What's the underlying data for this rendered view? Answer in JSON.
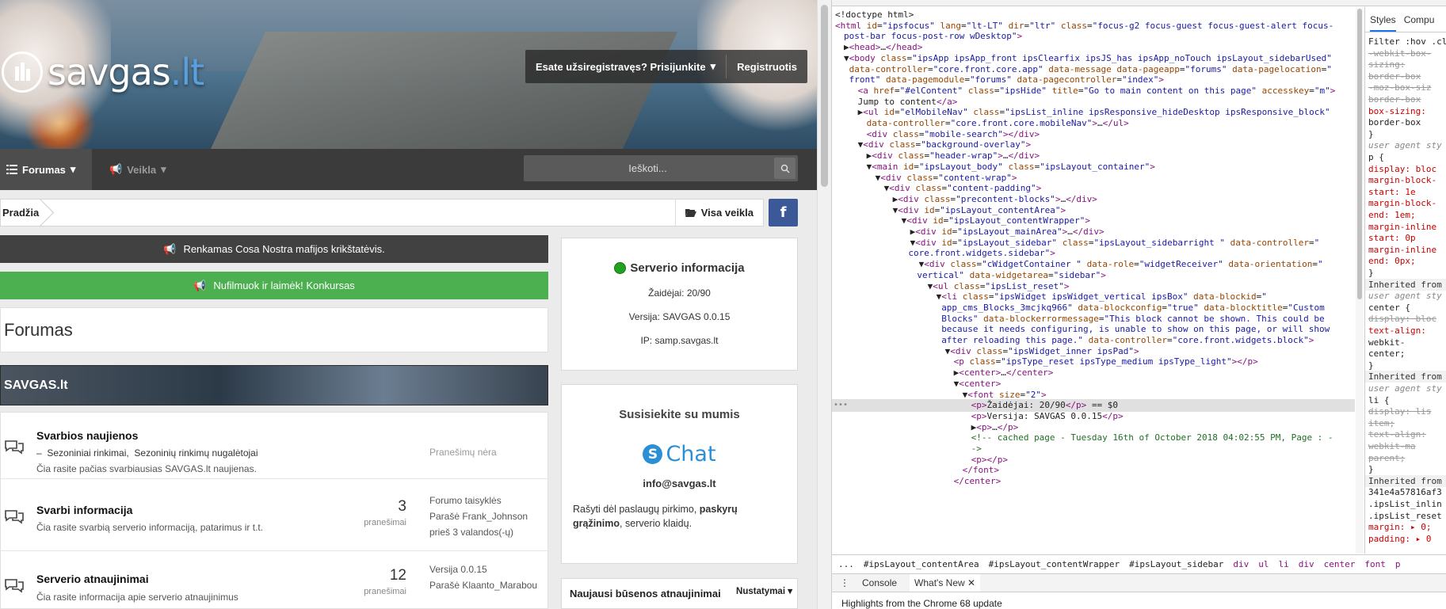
{
  "site": {
    "logo": {
      "name": "savgas",
      "tld": ".lt"
    },
    "userbar": {
      "login": "Esate užsiregistravęs? Prisijunkite",
      "register": "Registruotis"
    },
    "nav": {
      "forums": "Forumas",
      "activity": "Veikla"
    },
    "search": {
      "placeholder": "Ieškoti..."
    },
    "breadcrumb": {
      "home": "Pradžia",
      "all_activity": "Visa veikla"
    },
    "facebook": "f",
    "announcements": [
      "Renkamas Cosa Nostra mafijos krikštatėvis.",
      "Nufilmuok ir laimėk! Konkursas"
    ],
    "page_title": "Forumas",
    "category": "SAVGAS.lt",
    "forums": [
      {
        "title": "Svarbios naujienos",
        "subforums": [
          "Sezoniniai rinkimai,",
          "Sezoninių rinkimų nugalėtojai"
        ],
        "desc": "Čia rasite pačias svarbiausias SAVGAS.lt naujienas.",
        "empty": "Pranešimų nėra"
      },
      {
        "title": "Svarbi informacija",
        "desc": "Čia rasite svarbią serverio informaciją, patarimus ir t.t.",
        "count": "3",
        "count_label": "pranešimai",
        "last_title": "Forumo taisyklės",
        "last_by": "Parašė Frank_Johnson",
        "last_time": "prieš 3 valandos(-ų)"
      },
      {
        "title": "Serverio atnaujinimai",
        "desc": "Čia rasite informacija apie serverio atnaujinimus",
        "count": "12",
        "count_label": "pranešimai",
        "last_title": "Versija 0.0.15",
        "last_by": "Parašė Klaanto_Marabou"
      }
    ],
    "server_widget": {
      "title": "Serverio informacija",
      "players": "Žaidėjai: 20/90",
      "version": "Versija: SAVGAS 0.0.15",
      "ip_label": "IP: ",
      "ip": "samp.savgas.lt",
      "status_color": "#22a022"
    },
    "contact_widget": {
      "title": "Susisiekite su mumis",
      "chat": "Chat",
      "email": "info@savgas.lt",
      "text_pre": "Rašyti dėl paslaugų pirkimo, ",
      "text_bold": "paskyrų grąžinimo",
      "text_post": ", serverio klaidų."
    },
    "status_widget": {
      "title": "Naujausi būsenos atnaujinimai",
      "settings": "Nustatymai"
    }
  },
  "devtools": {
    "styles_tabs": [
      "Styles",
      "Compu"
    ],
    "styles_lines": [
      {
        "t": "Filter :hov .cl",
        "c": ""
      },
      {
        "t": "-webkit-box-",
        "c": "s"
      },
      {
        "t": "  sizing:",
        "c": "s"
      },
      {
        "t": "  border-box",
        "c": "s"
      },
      {
        "t": "-moz-box-siz",
        "c": "s"
      },
      {
        "t": "  border-box",
        "c": "s"
      },
      {
        "t": "box-sizing:",
        "c": "k"
      },
      {
        "t": "  border-box",
        "c": ""
      },
      {
        "t": "}",
        "c": ""
      },
      {
        "t": "user agent sty",
        "c": "g"
      },
      {
        "t": "p {",
        "c": ""
      },
      {
        "t": "  display: bloc",
        "c": "k"
      },
      {
        "t": "  margin-block-",
        "c": "k"
      },
      {
        "t": "    start: 1e",
        "c": "k"
      },
      {
        "t": "  margin-block-",
        "c": "k"
      },
      {
        "t": "    end: 1em;",
        "c": "k"
      },
      {
        "t": "  margin-inline",
        "c": "k"
      },
      {
        "t": "    start: 0p",
        "c": "k"
      },
      {
        "t": "  margin-inline",
        "c": "k"
      },
      {
        "t": "    end: 0px;",
        "c": "k"
      },
      {
        "t": "}",
        "c": ""
      },
      {
        "t": "Inherited from ce",
        "c": "h"
      },
      {
        "t": "user agent sty",
        "c": "g"
      },
      {
        "t": "center {",
        "c": ""
      },
      {
        "t": "  display: bloc",
        "c": "s"
      },
      {
        "t": "  text-align:",
        "c": "k"
      },
      {
        "t": "    webkit-",
        "c": ""
      },
      {
        "t": "    center;",
        "c": ""
      },
      {
        "t": "}",
        "c": ""
      },
      {
        "t": "Inherited from li",
        "c": "h"
      },
      {
        "t": "user agent sty",
        "c": "g"
      },
      {
        "t": "li {",
        "c": ""
      },
      {
        "t": "  display: lis",
        "c": "s"
      },
      {
        "t": "    item;",
        "c": "s"
      },
      {
        "t": "  text-align:",
        "c": "s"
      },
      {
        "t": "    webkit-ma",
        "c": "s"
      },
      {
        "t": "    parent;",
        "c": "s"
      },
      {
        "t": "}",
        "c": ""
      },
      {
        "t": "Inherited from ul",
        "c": "h"
      },
      {
        "t": "341e4a57816af3",
        "c": ""
      },
      {
        "t": ".ipsList_inlin",
        "c": ""
      },
      {
        "t": ".ipsList_reset",
        "c": ""
      },
      {
        "t": "  margin: ▸ 0;",
        "c": "k"
      },
      {
        "t": "  padding: ▸ 0",
        "c": "k"
      }
    ],
    "dom_lines": [
      {
        "i": 0,
        "h": "<span class='tx'>&lt;!doctype html&gt;</span>"
      },
      {
        "i": 0,
        "h": "<span class='tg'>&lt;html</span> <span class='at'>id</span>=<span class='av'>\"ipsfocus\"</span> <span class='at'>lang</span>=<span class='av'>\"lt-LT\"</span> <span class='at'>dir</span>=<span class='av'>\"ltr\"</span> <span class='at'>class</span>=<span class='av'>\"focus-g2 focus-guest focus-guest-alert focus-</span>"
      },
      {
        "i": -1,
        "h": "<span class='av'>post-bar focus-post-row wDesktop\"</span><span class='tg'>&gt;</span>"
      },
      {
        "i": 1,
        "h": "▶<span class='tg'>&lt;head&gt;</span>…<span class='tg'>&lt;/head&gt;</span>"
      },
      {
        "i": 1,
        "h": "▼<span class='tg'>&lt;body</span> <span class='at'>class</span>=<span class='av'>\"ipsApp ipsApp_front ipsClearfix ipsJS_has ipsApp_noTouch ipsLayout_sidebarUsed\"</span>"
      },
      {
        "i": 1.6,
        "h": "<span class='at'>data-controller</span>=<span class='av'>\"core.front.core.app\"</span> <span class='at'>data-message</span> <span class='at'>data-pageapp</span>=<span class='av'>\"forums\"</span> <span class='at'>data-pagelocation</span>=<span class='av'>\"</span>"
      },
      {
        "i": 1.6,
        "h": "<span class='av'>front\"</span> <span class='at'>data-pagemodule</span>=<span class='av'>\"forums\"</span> <span class='at'>data-pagecontroller</span>=<span class='av'>\"index\"</span><span class='tg'>&gt;</span>"
      },
      {
        "i": 2.6,
        "h": "<span class='tg'>&lt;a</span> <span class='at'>href</span>=<span class='av'>\"#elContent\"</span> <span class='at'>class</span>=<span class='av'>\"ipsHide\"</span> <span class='at'>title</span>=<span class='av'>\"Go to main content on this page\"</span> <span class='at'>accesskey</span>=<span class='av'>\"m\"</span><span class='tg'>&gt;</span>"
      },
      {
        "i": 2.6,
        "h": "<span class='tx'>Jump to content</span><span class='tg'>&lt;/a&gt;</span>"
      },
      {
        "i": 2.6,
        "h": "▶<span class='tg'>&lt;ul</span> <span class='at'>id</span>=<span class='av'>\"elMobileNav\"</span> <span class='at'>class</span>=<span class='av'>\"ipsList_inline ipsResponsive_hideDesktop ipsResponsive_block\"</span>"
      },
      {
        "i": 3.6,
        "h": "<span class='at'>data-controller</span>=<span class='av'>\"core.front.core.mobileNav\"</span><span class='tg'>&gt;</span>…<span class='tg'>&lt;/ul&gt;</span>"
      },
      {
        "i": 3.6,
        "h": "<span class='tg'>&lt;div</span> <span class='at'>class</span>=<span class='av'>\"mobile-search\"</span><span class='tg'>&gt;&lt;/div&gt;</span>"
      },
      {
        "i": 2.6,
        "h": "▼<span class='tg'>&lt;div</span> <span class='at'>class</span>=<span class='av'>\"background-overlay\"</span><span class='tg'>&gt;</span>"
      },
      {
        "i": 3.6,
        "h": "▶<span class='tg'>&lt;div</span> <span class='at'>class</span>=<span class='av'>\"header-wrap\"</span><span class='tg'>&gt;</span>…<span class='tg'>&lt;/div&gt;</span>"
      },
      {
        "i": 3.6,
        "h": "▼<span class='tg'>&lt;main</span> <span class='at'>id</span>=<span class='av'>\"ipsLayout_body\"</span> <span class='at'>class</span>=<span class='av'>\"ipsLayout_container\"</span><span class='tg'>&gt;</span>"
      },
      {
        "i": 4.6,
        "h": "▼<span class='tg'>&lt;div</span> <span class='at'>class</span>=<span class='av'>\"content-wrap\"</span><span class='tg'>&gt;</span>"
      },
      {
        "i": 5.6,
        "h": "▼<span class='tg'>&lt;div</span> <span class='at'>class</span>=<span class='av'>\"content-padding\"</span><span class='tg'>&gt;</span>"
      },
      {
        "i": 6.6,
        "h": "▶<span class='tg'>&lt;div</span> <span class='at'>class</span>=<span class='av'>\"precontent-blocks\"</span><span class='tg'>&gt;</span>…<span class='tg'>&lt;/div&gt;</span>"
      },
      {
        "i": 6.6,
        "h": "▼<span class='tg'>&lt;div</span> <span class='at'>id</span>=<span class='av'>\"ipsLayout_contentArea\"</span><span class='tg'>&gt;</span>"
      },
      {
        "i": 7.6,
        "h": "▼<span class='tg'>&lt;div</span> <span class='at'>id</span>=<span class='av'>\"ipsLayout_contentWrapper\"</span><span class='tg'>&gt;</span>"
      },
      {
        "i": 8.6,
        "h": "▶<span class='tg'>&lt;div</span> <span class='at'>id</span>=<span class='av'>\"ipsLayout_mainArea\"</span><span class='tg'>&gt;</span>…<span class='tg'>&lt;/div&gt;</span>"
      },
      {
        "i": 8.6,
        "h": "▼<span class='tg'>&lt;div</span> <span class='at'>id</span>=<span class='av'>\"ipsLayout_sidebar\"</span> <span class='at'>class</span>=<span class='av'>\"ipsLayout_sidebarright \"</span> <span class='at'>data-controller</span>=<span class='av'>\"</span>"
      },
      {
        "i": 8.4,
        "h": "<span class='av'>core.front.widgets.sidebar\"</span><span class='tg'>&gt;</span>"
      },
      {
        "i": 9.6,
        "h": "▼<span class='tg'>&lt;div</span> <span class='at'>class</span>=<span class='av'>\"cWidgetContainer \"</span> <span class='at'>data-role</span>=<span class='av'>\"widgetReceiver\"</span> <span class='at'>data-orientation</span>=<span class='av'>\"</span>"
      },
      {
        "i": 9.4,
        "h": "<span class='av'>vertical\"</span> <span class='at'>data-widgetarea</span>=<span class='av'>\"sidebar\"</span><span class='tg'>&gt;</span>"
      },
      {
        "i": 10.6,
        "h": "▼<span class='tg'>&lt;ul</span> <span class='at'>class</span>=<span class='av'>\"ipsList_reset\"</span><span class='tg'>&gt;</span>"
      },
      {
        "i": 11.6,
        "h": "▼<span class='tg'>&lt;li</span> <span class='at'>class</span>=<span class='av'>\"ipsWidget ipsWidget_vertical ipsBox\"</span> <span class='at'>data-blockid</span>=<span class='av'>\"</span>"
      },
      {
        "i": 12.2,
        "h": "<span class='av'>app_cms_Blocks_3mcjkq966\"</span> <span class='at'>data-blockconfig</span>=<span class='av'>\"true\"</span> <span class='at'>data-blocktitle</span>=<span class='av'>\"Custom</span>"
      },
      {
        "i": 12.2,
        "h": "<span class='av'>Blocks\"</span> <span class='at'>data-blockerrormessage</span>=<span class='av'>\"This block cannot be shown. This could be</span>"
      },
      {
        "i": 12.2,
        "h": "<span class='av'>because it needs configuring, is unable to show on this page, or will show</span>"
      },
      {
        "i": 12.2,
        "h": "<span class='av'>after reloading this page.\"</span> <span class='at'>data-controller</span>=<span class='av'>\"core.front.widgets.block\"</span><span class='tg'>&gt;</span>"
      },
      {
        "i": 12.6,
        "h": "▼<span class='tg'>&lt;div</span> <span class='at'>class</span>=<span class='av'>\"ipsWidget_inner ipsPad\"</span><span class='tg'>&gt;</span>"
      },
      {
        "i": 13.6,
        "h": "<span class='tg'>&lt;p</span> <span class='at'>class</span>=<span class='av'>\"ipsType_reset ipsType_medium ipsType_light\"</span><span class='tg'>&gt;&lt;/p&gt;</span>"
      },
      {
        "i": 13.6,
        "h": "▶<span class='tg'>&lt;center&gt;</span>…<span class='tg'>&lt;/center&gt;</span>"
      },
      {
        "i": 13.6,
        "h": "▼<span class='tg'>&lt;center&gt;</span>"
      },
      {
        "i": 14.6,
        "h": "▼<span class='tg'>&lt;font</span> <span class='at'>size</span>=<span class='av'>\"2\"</span><span class='tg'>&gt;</span>"
      },
      {
        "i": 15.6,
        "h": "<span class='tg'>&lt;p&gt;</span><span class='tx'>Žaidėjai: 20/90</span><span class='tg'>&lt;/p&gt;</span> <span class='tx'>== $0</span>",
        "sel": true
      },
      {
        "i": 15.6,
        "h": "<span class='tg'>&lt;p&gt;</span><span class='tx'>Versija: SAVGAS 0.0.15</span><span class='tg'>&lt;/p&gt;</span>"
      },
      {
        "i": 15.6,
        "h": "▶<span class='tg'>&lt;p&gt;</span>…<span class='tg'>&lt;/p&gt;</span>"
      },
      {
        "i": 15.6,
        "h": "<span class='cm'>&lt;!-- cached page - Tuesday 16th of October 2018 04:02:55 PM, Page :  -</span>"
      },
      {
        "i": 15.6,
        "h": "<span class='cm'>-&gt;</span>"
      },
      {
        "i": 15.6,
        "h": "<span class='tg'>&lt;p&gt;&lt;/p&gt;</span>"
      },
      {
        "i": 14.6,
        "h": "<span class='tg'>&lt;/font&gt;</span>"
      },
      {
        "i": 13.6,
        "h": "<span class='tg'>&lt;/center&gt;</span>"
      }
    ],
    "breadcrumb": [
      "...",
      "#ipsLayout_contentArea",
      "#ipsLayout_contentWrapper",
      "#ipsLayout_sidebar",
      "div",
      "ul",
      "li",
      "div",
      "center",
      "font",
      "p"
    ],
    "drawer_tabs": [
      "Console",
      "What's New"
    ],
    "drawer_text": "Highlights from the Chrome 68 update",
    "selected_marker": "•••"
  }
}
